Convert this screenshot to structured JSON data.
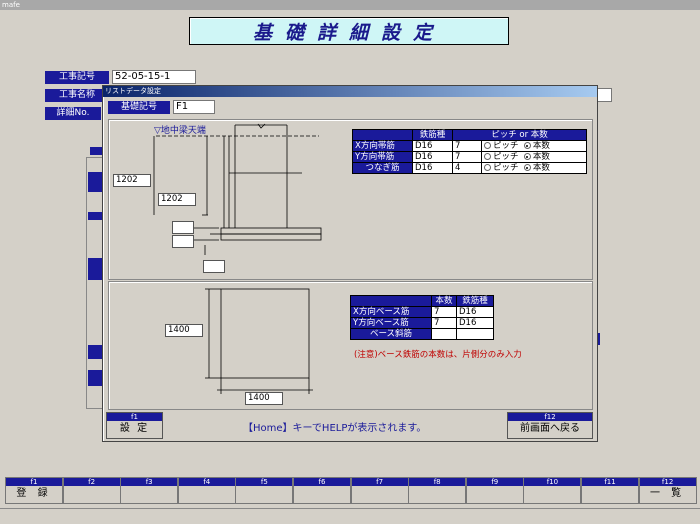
{
  "window": {
    "title": "mafe"
  },
  "main": {
    "title": "基礎詳細設定",
    "koji_kigo_label": "工事記号",
    "koji_kigo_value": "52-05-15-1",
    "koji_mei_label": "工事名称",
    "shosai_label": "詳細No."
  },
  "dialog": {
    "title": "リストデータ設定",
    "kiso_label": "基礎記号",
    "kiso_value": "F1",
    "top": {
      "level_label": "▽地中梁天端",
      "dim_outer": "1202",
      "dim_inner": "1202",
      "table": {
        "headers": [
          "鉄筋種",
          "ピッチ or 本数"
        ],
        "pitch_label": "ピッチ",
        "count_label": "本数",
        "rows": [
          {
            "label": "X方向帯筋",
            "type": "D16",
            "value": "7"
          },
          {
            "label": "Y方向帯筋",
            "type": "D16",
            "value": "7"
          },
          {
            "label": "つなぎ筋",
            "type": "D16",
            "value": "4"
          }
        ]
      }
    },
    "bottom": {
      "dim_side": "1400",
      "dim_bottom": "1400",
      "table": {
        "headers": [
          "本数",
          "鉄筋種"
        ],
        "rows": [
          {
            "label": "X方向ベース筋",
            "count": "7",
            "type": "D16"
          },
          {
            "label": "Y方向ベース筋",
            "count": "7",
            "type": "D16"
          },
          {
            "label": "ベース斜筋",
            "count": "",
            "type": ""
          }
        ]
      },
      "note": "(注意)ベース鉄筋の本数は、片側分のみ入力"
    },
    "f1": {
      "key": "f1",
      "label": "設 定"
    },
    "f12": {
      "key": "f12",
      "label": "前画面へ戻る"
    },
    "help": "【Home】キーでHELPが表示されます。"
  },
  "fkeys": [
    {
      "key": "f1",
      "label": "登 録"
    },
    {
      "key": "f2",
      "label": ""
    },
    {
      "key": "f3",
      "label": ""
    },
    {
      "key": "f4",
      "label": ""
    },
    {
      "key": "f5",
      "label": ""
    },
    {
      "key": "f6",
      "label": ""
    },
    {
      "key": "f7",
      "label": ""
    },
    {
      "key": "f8",
      "label": ""
    },
    {
      "key": "f9",
      "label": ""
    },
    {
      "key": "f10",
      "label": ""
    },
    {
      "key": "f11",
      "label": ""
    },
    {
      "key": "f12",
      "label": "一 覧"
    }
  ]
}
